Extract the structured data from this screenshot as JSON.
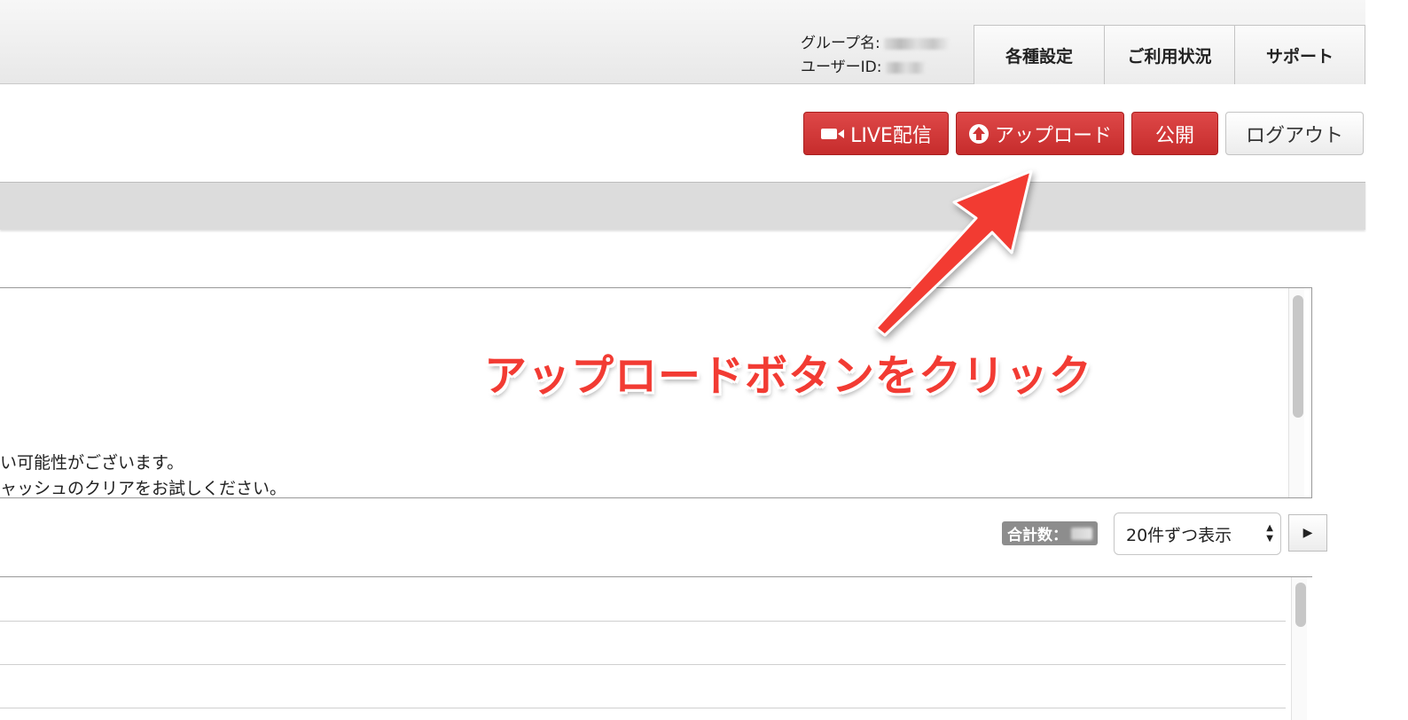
{
  "account": {
    "group_label": "グループ名:",
    "user_label": "ユーザーID:"
  },
  "nav": {
    "settings": "各種設定",
    "usage": "ご利用状況",
    "support": "サポート"
  },
  "actions": {
    "live": "LIVE配信",
    "upload": "アップロード",
    "publish": "公開",
    "logout": "ログアウト"
  },
  "notice": {
    "line1": "い可能性がございます。",
    "line2": "ャッシュのクリアをお試しください。"
  },
  "pagination": {
    "total_label": "合計数：",
    "per_page": "20件ずつ表示",
    "next_icon": "play-triangle-icon"
  },
  "annotation": {
    "callout": "アップロードボタンをクリック"
  },
  "colors": {
    "primary_red": "#d33a3a",
    "annotation_red": "#f23b33"
  }
}
